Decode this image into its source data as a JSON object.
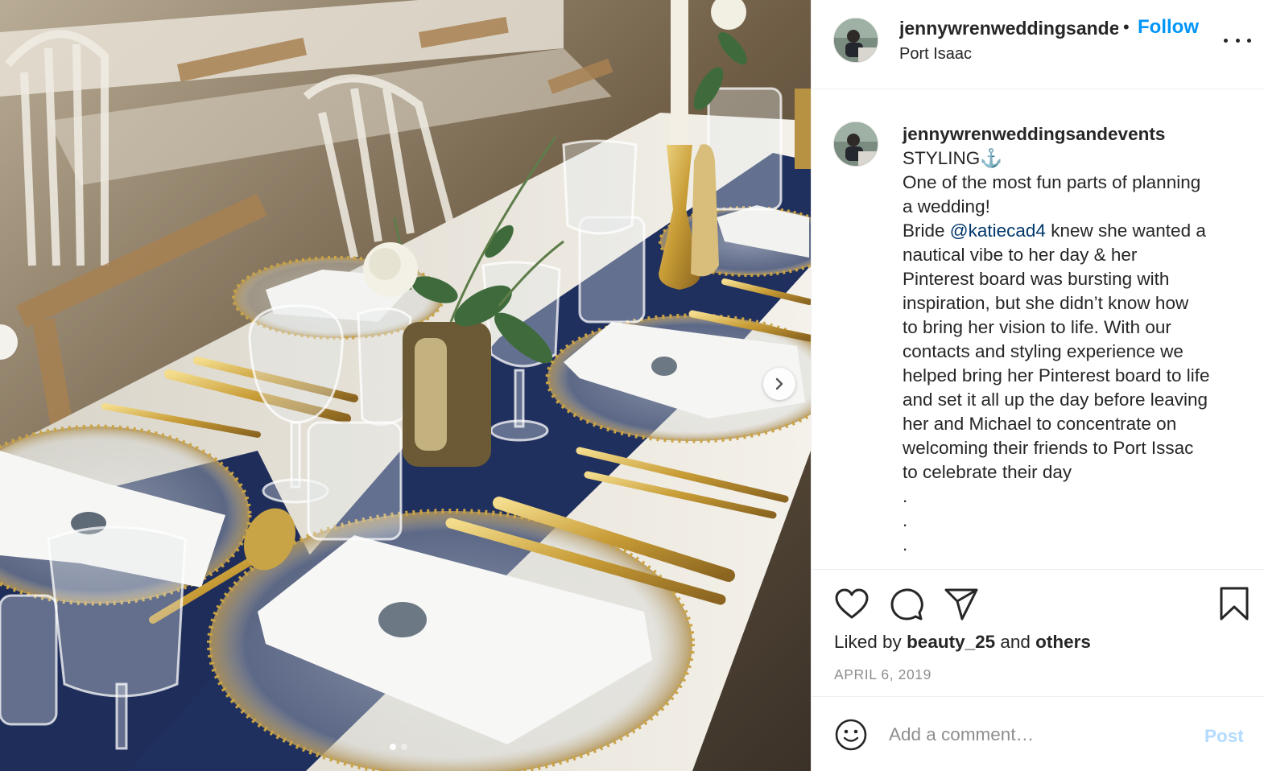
{
  "header": {
    "username": "jennywrenweddingsandevents",
    "separator": "•",
    "follow_label": "Follow",
    "location": "Port Isaac",
    "more_icon": "more-horizontal-icon"
  },
  "caption": {
    "username": "jennywrenweddingsandevents",
    "lines": [
      "STYLING⚓️",
      "One of the most fun parts of planning",
      "a wedding!",
      "knew she wanted a",
      "nautical vibe to her day & her",
      "Pinterest board was bursting with",
      "inspiration, but she didn’t know how",
      "to bring her vision to life. With our",
      "contacts and styling experience we",
      "helped bring her Pinterest board to life",
      "and set it all up the day before leaving",
      "her and Michael to concentrate on",
      "welcoming their friends to Port Issac",
      "to celebrate their day",
      ".",
      ".",
      "."
    ],
    "bride_prefix": "Bride ",
    "mention": "@katiecad4"
  },
  "actions": {
    "icons": [
      "heart-icon",
      "comment-icon",
      "share-icon",
      "bookmark-icon"
    ],
    "liked_prefix": "Liked by ",
    "liked_user": "beauty_25",
    "liked_mid": " and ",
    "liked_others": "others",
    "date": "APRIL 6, 2019"
  },
  "comment": {
    "placeholder": "Add a comment…",
    "post_label": "Post"
  },
  "media": {
    "slide_count": 2,
    "active_slide": 1,
    "colors": {
      "runner": "#1f2f5e",
      "gold": "#c9a447",
      "tablecloth": "#ece9e1"
    }
  },
  "colors": {
    "follow": "#0095f6",
    "post_disabled": "#b3dbff",
    "mention": "#00376b",
    "muted": "#8e8e8e"
  }
}
